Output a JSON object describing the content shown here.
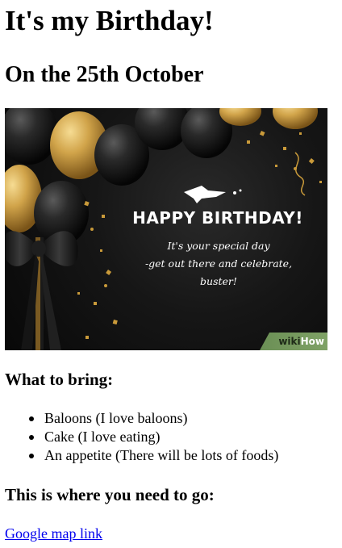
{
  "page": {
    "title": "It's my Birthday!",
    "subtitle": "On the 25th October"
  },
  "card": {
    "headline": "HAPPY BIRTHDAY!",
    "message_lines": [
      "It's your special day",
      "-get out there and celebrate,",
      "buster!"
    ],
    "watermark_prefix": "wiki",
    "watermark_suffix": "How"
  },
  "bring": {
    "heading": "What to bring:",
    "items": [
      "Baloons (I love baloons)",
      "Cake (I love eating)",
      "An appetite (There will be lots of foods)"
    ]
  },
  "location": {
    "heading": "This is where you need to go:",
    "link_text": "Google map link"
  },
  "colors": {
    "link": "#0000ee",
    "gold": "#c99a3a",
    "card_bg": "#111111"
  }
}
